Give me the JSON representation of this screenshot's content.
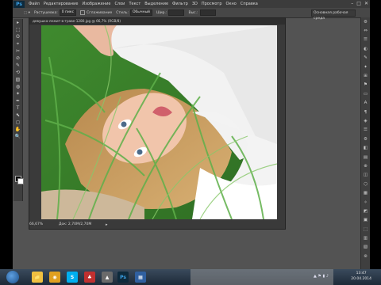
{
  "app": {
    "logo": "Ps"
  },
  "menu": [
    "Файл",
    "Редактирование",
    "Изображение",
    "Слои",
    "Текст",
    "Выделение",
    "Фильтр",
    "3D",
    "Просмотр",
    "Окно",
    "Справка"
  ],
  "window_controls": [
    "–",
    "□",
    "✕"
  ],
  "options_bar": {
    "feather_label": "Растушевка:",
    "feather_value": "0 пикс",
    "antialias_label": "Сглаживание",
    "style_label": "Стиль:",
    "style_value": "Обычный",
    "width_label": "Шир.:",
    "height_label": "Выс.:",
    "workspace": "Основная рабочая среда"
  },
  "document": {
    "tab_title": "девушка-лежит-в-траве-1280.jpg @ 66,7% (RGB/8)",
    "zoom": "66,67%",
    "doc_info": "Док: 2,70М/2,70М",
    "arrow": "▸"
  },
  "tools": [
    "▸",
    "⬚",
    "ʘ",
    "⌖",
    "✂",
    "⊘",
    "✎",
    "⟲",
    "▨",
    "◍",
    "✦",
    "✒",
    "T",
    "⬉",
    "◻",
    "✋",
    "🔍"
  ],
  "right_panel": [
    "⚙",
    "⇔",
    "☰",
    "◐",
    "✎",
    "✦",
    "⊞",
    "⚑",
    "▭",
    "A",
    "¶",
    "◈",
    "☰",
    "⚙",
    "◧",
    "▤",
    "⊕",
    "◫",
    "⬡",
    "▦",
    "✧",
    "◩",
    "▣",
    "⬚",
    "▥",
    "▧",
    "⊛"
  ],
  "taskbar": {
    "apps": [
      {
        "label": "📁",
        "color": "#f0c040"
      },
      {
        "label": "◉",
        "color": "#e0a020"
      },
      {
        "label": "S",
        "color": "#00aff0"
      },
      {
        "label": "♣",
        "color": "#c03030"
      },
      {
        "label": "▲",
        "color": "#6a6a6a"
      },
      {
        "label": "Ps",
        "color": "#0e2a3c"
      },
      {
        "label": "▦",
        "color": "#3060a0"
      }
    ],
    "tray": "▲  ⚑  ▮  ♪",
    "time": "13:47",
    "date": "20.04.2014"
  }
}
